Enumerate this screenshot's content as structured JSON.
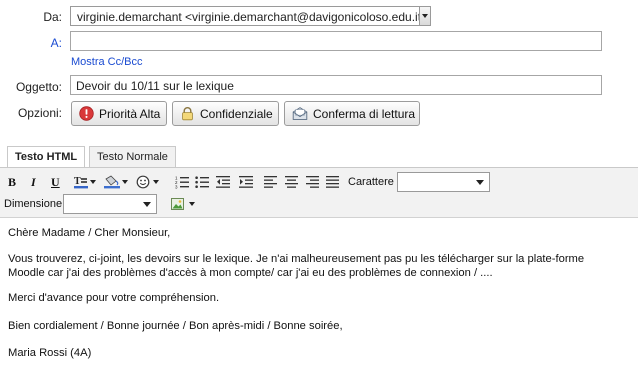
{
  "header": {
    "from_label": "Da:",
    "from_value": "virginie.demarchant <virginie.demarchant@davigonicoloso.edu.it>",
    "to_label": "A:",
    "to_value": "",
    "cc_link": "Mostra Cc/Bcc",
    "subject_label": "Oggetto:",
    "subject_value": "Devoir du 10/11 sur le lexique",
    "options_label": "Opzioni:"
  },
  "options": {
    "priority": "Priorità Alta",
    "confidential": "Confidenziale",
    "read_receipt": "Conferma di lettura"
  },
  "tabs": {
    "html": "Testo HTML",
    "plain": "Testo Normale",
    "active": "html"
  },
  "toolbar": {
    "bold": "B",
    "italic": "I",
    "underline": "U",
    "font_label": "Carattere",
    "font_value": "",
    "size_label": "Dimensione",
    "size_value": ""
  },
  "message": {
    "greeting": "Chère Madame / Cher Monsieur,",
    "line1": "Vous trouverez, ci-joint, les devoirs sur le lexique. Je n'ai malheureusement pas pu les télécharger sur la plate-forme",
    "line2": "Moodle car j'ai des problèmes d'accès à mon compte/ car j'ai eu des problèmes de connexion / ....",
    "thanks": "Merci d'avance pour votre compréhension.",
    "closing": "Bien cordialement / Bonne journée / Bon après-midi / Bonne soirée,",
    "signature": "Maria Rossi (4A)"
  },
  "colors": {
    "link": "#1a4bd1",
    "toolbar_bg": "#f2f2f2",
    "priority_icon": "#d9383a"
  }
}
